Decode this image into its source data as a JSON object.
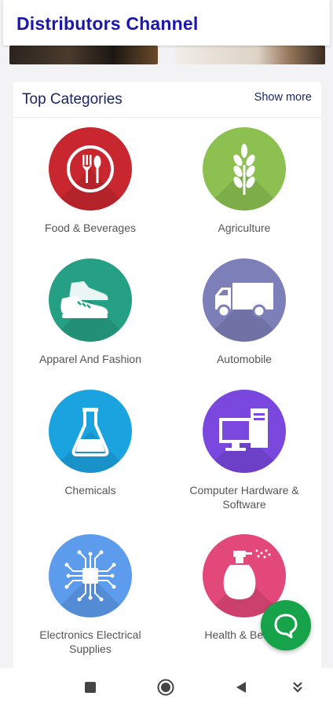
{
  "header": {
    "title": "Distributors Channel"
  },
  "section": {
    "title": "Top Categories",
    "show_more_label": "Show more"
  },
  "categories": [
    {
      "label": "Food & Beverages",
      "icon": "fork-spoon-icon",
      "color": "#c9272f"
    },
    {
      "label": "Agriculture",
      "icon": "wheat-icon",
      "color": "#8cc152"
    },
    {
      "label": "Apparel And Fashion",
      "icon": "sneakers-icon",
      "color": "#26a085"
    },
    {
      "label": "Automobile",
      "icon": "truck-icon",
      "color": "#7d7fb8"
    },
    {
      "label": "Chemicals",
      "icon": "flask-icon",
      "color": "#1ba3e0"
    },
    {
      "label": "Computer Hardware & Software",
      "icon": "computer-icon",
      "color": "#7a48df"
    },
    {
      "label": "Electronics Electrical Supplies",
      "icon": "circuit-chip-icon",
      "color": "#5d9cec"
    },
    {
      "label": "Health & Beauty",
      "icon": "perfume-bottle-icon",
      "color": "#e2487a"
    }
  ],
  "chat": {
    "icon": "chat-bubble-icon",
    "color": "#16a34a"
  },
  "nav": {
    "items": [
      "recent-apps-icon",
      "home-icon",
      "back-icon",
      "notification-pull-icon"
    ]
  }
}
